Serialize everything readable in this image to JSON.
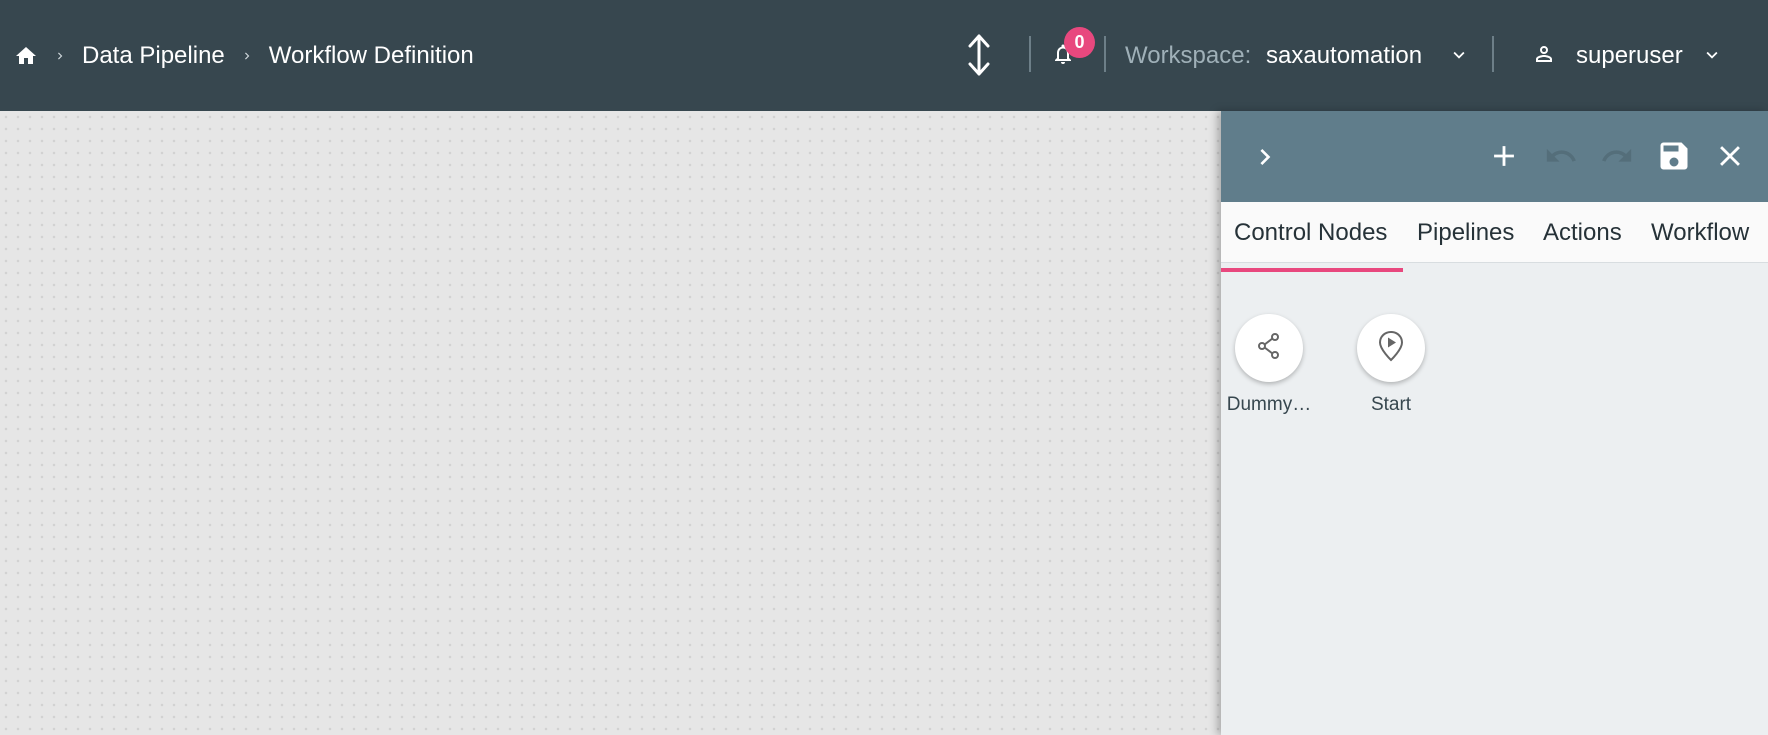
{
  "breadcrumb": {
    "home_icon": "home-icon",
    "items": [
      "Data Pipeline",
      "Workflow Definition"
    ]
  },
  "header": {
    "notifications_count": "0",
    "workspace_label": "Workspace:",
    "workspace_value": "saxautomation",
    "user_name": "superuser"
  },
  "panel": {
    "toolbar_icons": [
      "chevron-right-icon",
      "plus-icon",
      "undo-icon",
      "redo-icon",
      "save-icon",
      "close-icon"
    ],
    "tabs": [
      "Control Nodes",
      "Pipelines",
      "Actions",
      "Workflow"
    ],
    "active_tab": "Control Nodes",
    "nodes": [
      {
        "label": "Dummy…",
        "icon": "share-icon"
      },
      {
        "label": "Start",
        "icon": "play-pin-icon"
      }
    ]
  },
  "colors": {
    "header_bg": "#37474f",
    "panel_head_bg": "#607d8b",
    "accent": "#e8487e",
    "canvas_bg": "#e6e6e6"
  }
}
